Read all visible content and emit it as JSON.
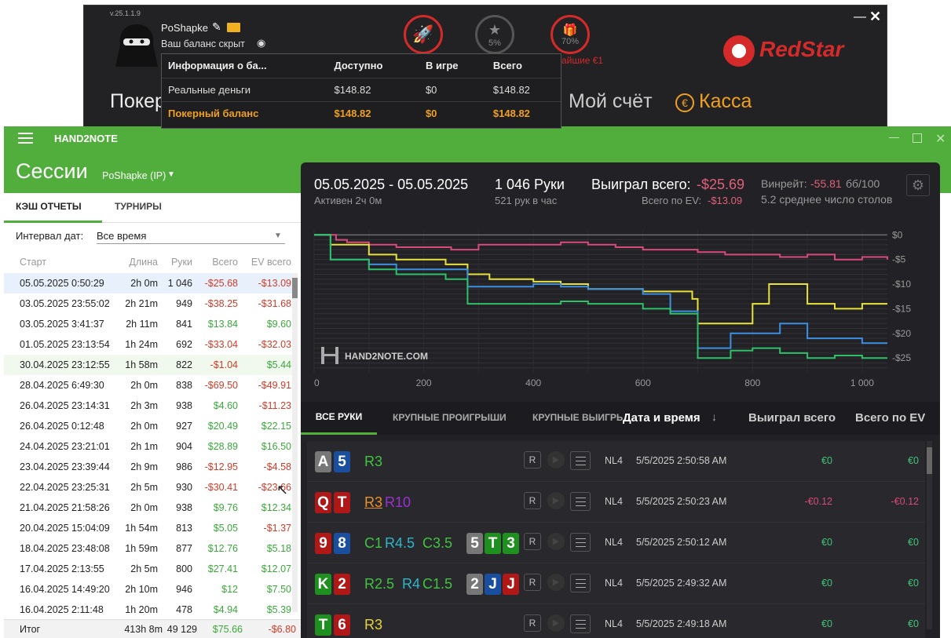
{
  "redstar": {
    "version": "v.25.1.1.9",
    "username": "PoShapke",
    "balance_hidden": "Ваш баланс скрыт",
    "badge1": "5%",
    "badge2": "70%",
    "promo": "айшие €1",
    "nav_poker": "Покер",
    "nav_account": "Мой счёт",
    "nav_cashier": "Касса",
    "brand": "RedStar",
    "minimize": "—",
    "close": "✕",
    "balance_table": {
      "headers": [
        "Информация о ба...",
        "Доступно",
        "В игре",
        "Всего"
      ],
      "rows": [
        [
          "Реальные деньги",
          "$148.82",
          "$0",
          "$148.82"
        ],
        [
          "Покерный баланс",
          "$148.82",
          "$0",
          "$148.82"
        ]
      ]
    }
  },
  "h2n": {
    "title": "HAND2NOTE",
    "page_title": "Сессии",
    "player": "PoShapke (IP)",
    "tabs": [
      "КЭШ ОТЧЕТЫ",
      "ТУРНИРЫ"
    ],
    "interval_label": "Интервал дат:",
    "interval_value": "Все время",
    "columns": [
      "Старт",
      "Длина",
      "Руки",
      "Всего",
      "EV всего"
    ],
    "sessions": [
      [
        "05.05.2025 0:50:29",
        "2h 0m",
        "1 046",
        "-$25.68",
        "-$13.09"
      ],
      [
        "03.05.2025 23:55:02",
        "2h 21m",
        "949",
        "-$38.25",
        "-$31.68"
      ],
      [
        "03.05.2025 3:41:37",
        "2h 11m",
        "841",
        "$13.84",
        "$9.60"
      ],
      [
        "01.05.2025 23:13:54",
        "1h 24m",
        "692",
        "-$33.04",
        "-$32.03"
      ],
      [
        "30.04.2025 23:12:55",
        "1h 58m",
        "822",
        "-$1.04",
        "$5.44"
      ],
      [
        "28.04.2025 6:49:30",
        "2h 0m",
        "838",
        "-$69.50",
        "-$49.91"
      ],
      [
        "26.04.2025 23:14:31",
        "2h 3m",
        "938",
        "$4.60",
        "-$11.23"
      ],
      [
        "26.04.2025 0:12:48",
        "2h 0m",
        "927",
        "$20.49",
        "$22.15"
      ],
      [
        "24.04.2025 23:21:01",
        "2h 1m",
        "904",
        "$28.89",
        "$16.50"
      ],
      [
        "23.04.2025 23:39:44",
        "2h 9m",
        "986",
        "-$12.95",
        "-$4.58"
      ],
      [
        "22.04.2025 23:25:31",
        "2h 5m",
        "930",
        "-$30.41",
        "-$23.66"
      ],
      [
        "21.04.2025 21:58:26",
        "2h 0m",
        "938",
        "$9.76",
        "$12.34"
      ],
      [
        "20.04.2025 15:04:09",
        "1h 54m",
        "813",
        "$5.05",
        "-$1.37"
      ],
      [
        "18.04.2025 23:48:08",
        "1h 59m",
        "877",
        "$12.76",
        "$5.18"
      ],
      [
        "17.04.2025 2:13:55",
        "2h 5m",
        "800",
        "$27.41",
        "$12.07"
      ],
      [
        "16.04.2025 14:49:20",
        "2h 10m",
        "946",
        "$12",
        "$7.50"
      ],
      [
        "16.04.2025 2:11:48",
        "1h 20m",
        "478",
        "$4.94",
        "$5.39"
      ]
    ],
    "total": [
      "Итог",
      "413h 8m",
      "49 129",
      "$75.66",
      "-$6.80"
    ],
    "detail": {
      "date_range": "05.05.2025 - 05.05.2025",
      "active": "Активен 2ч 0м",
      "hands": "1 046 Руки",
      "hands_per_hour": "521 рук в час",
      "won_label": "Выиграл всего:",
      "won_value": "-$25.69",
      "ev_label": "Всего по EV:",
      "ev_value": "-$13.09",
      "winrate_label": "Винрейт:",
      "winrate_value": "-55.81",
      "winrate_unit": "бб/100",
      "tables": "5.2 среднее число столов",
      "watermark": "HAND2NOTE.COM"
    },
    "hand_tabs": [
      "ВСЕ РУКИ",
      "КРУПНЫЕ ПРОИГРЫШИ",
      "КРУПНЫЕ ВЫИГРЫ"
    ],
    "hand_columns": [
      "Дата и время",
      "Выиграл всего",
      "Всего по EV"
    ],
    "hands": [
      {
        "cards": [
          [
            "A",
            "#777"
          ],
          [
            "5",
            "#1a4fa0"
          ]
        ],
        "actions": [
          [
            "R3",
            "#3ec43e"
          ]
        ],
        "board": [],
        "game": "NL4",
        "time": "5/5/2025 2:50:58 AM",
        "won": "€0",
        "ev": "€0"
      },
      {
        "cards": [
          [
            "Q",
            "#b01818"
          ],
          [
            "T",
            "#b01818"
          ]
        ],
        "actions": [
          [
            "R3",
            "#e8902a"
          ],
          [
            "R10",
            "#9b30d0"
          ]
        ],
        "board": [],
        "game": "NL4",
        "time": "5/5/2025 2:50:23 AM",
        "won": "-€0.12",
        "ev": "-€0.12"
      },
      {
        "cards": [
          [
            "9",
            "#b01818"
          ],
          [
            "8",
            "#1a4fa0"
          ]
        ],
        "actions": [
          [
            "C1",
            "#3ec43e"
          ],
          [
            "R4.5",
            "#2cb6c8"
          ],
          [
            "C3.5",
            "#3ec43e"
          ]
        ],
        "board": [
          [
            "5",
            "#777"
          ],
          [
            "T",
            "#1f8f1f"
          ],
          [
            "3",
            "#1f8f1f"
          ]
        ],
        "game": "NL4",
        "time": "5/5/2025 2:50:12 AM",
        "won": "€0",
        "ev": "€0"
      },
      {
        "cards": [
          [
            "K",
            "#1f8f1f"
          ],
          [
            "2",
            "#b01818"
          ]
        ],
        "actions": [
          [
            "R2.5",
            "#3ec43e"
          ],
          [
            "R4",
            "#2cb6c8"
          ],
          [
            "C1.5",
            "#3ec43e"
          ]
        ],
        "board": [
          [
            "2",
            "#777"
          ],
          [
            "J",
            "#1a4fa0"
          ],
          [
            "J",
            "#b01818"
          ]
        ],
        "game": "NL4",
        "time": "5/5/2025 2:49:32 AM",
        "won": "€0",
        "ev": "€0"
      },
      {
        "cards": [
          [
            "T",
            "#1f8f1f"
          ],
          [
            "6",
            "#b01818"
          ]
        ],
        "actions": [
          [
            "R3",
            "#e6d23a"
          ]
        ],
        "board": [],
        "game": "NL4",
        "time": "5/5/2025 2:49:18 AM",
        "won": "€0",
        "ev": "€0"
      }
    ]
  },
  "chart_data": {
    "type": "line",
    "x_ticks": [
      "0",
      "200",
      "400",
      "600",
      "800",
      "1 000"
    ],
    "y_ticks": [
      "$0",
      "-$5",
      "-$10",
      "-$15",
      "-$20",
      "-$25"
    ],
    "xlim": [
      0,
      1046
    ],
    "ylim": [
      -28,
      1
    ],
    "grid": true,
    "series": [
      {
        "color": "#d94a7a",
        "x": [
          0,
          40,
          60,
          100,
          150,
          200,
          250,
          300,
          400,
          450,
          500,
          550,
          600,
          700,
          750,
          800,
          850,
          900,
          950,
          1000,
          1046
        ],
        "y": [
          0,
          -1,
          -1.5,
          -2,
          -2.5,
          -2.5,
          -3,
          -2,
          -2,
          -1.5,
          -2,
          -2.5,
          -3,
          -3.5,
          -4,
          -4,
          -4.5,
          -4,
          -5,
          -4.5,
          -5
        ]
      },
      {
        "color": "#e8e23a",
        "x": [
          0,
          30,
          50,
          100,
          150,
          240,
          280,
          320,
          400,
          450,
          500,
          550,
          600,
          650,
          690,
          700,
          800,
          830,
          900,
          950,
          1000,
          1046
        ],
        "y": [
          0,
          -2,
          -2,
          -4,
          -5,
          -6,
          -8,
          -9,
          -9.5,
          -10,
          -11,
          -11,
          -11.5,
          -11.5,
          -13,
          -18,
          -14,
          -10,
          -14,
          -15,
          -14,
          -14
        ]
      },
      {
        "color": "#3d8fe0",
        "x": [
          0,
          30,
          50,
          100,
          150,
          240,
          280,
          320,
          400,
          450,
          500,
          550,
          600,
          650,
          690,
          700,
          760,
          800,
          850,
          900,
          950,
          1000,
          1046
        ],
        "y": [
          0,
          -5,
          -5,
          -6,
          -7,
          -7,
          -10.5,
          -10.5,
          -10,
          -10.5,
          -11,
          -11,
          -12,
          -15.5,
          -15.5,
          -23,
          -20,
          -20,
          -18,
          -21,
          -21,
          -22,
          -22
        ]
      },
      {
        "color": "#2fc06a",
        "x": [
          0,
          30,
          50,
          100,
          150,
          240,
          280,
          320,
          400,
          450,
          500,
          550,
          600,
          650,
          690,
          700,
          760,
          800,
          850,
          900,
          950,
          1000,
          1046
        ],
        "y": [
          0,
          -5,
          -5,
          -7,
          -8,
          -9,
          -14,
          -14,
          -14,
          -13.5,
          -14,
          -14,
          -15,
          -16,
          -16,
          -25,
          -23.5,
          -23,
          -24,
          -25,
          -24.5,
          -25,
          -25
        ]
      }
    ]
  }
}
